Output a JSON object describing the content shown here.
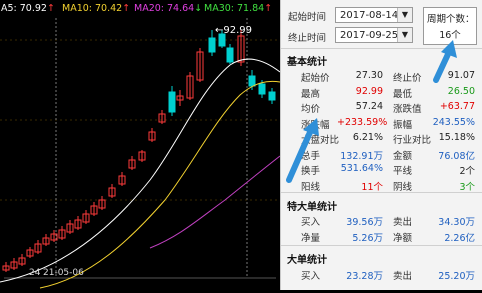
{
  "ma_legend": [
    {
      "label": "A5: 70.92",
      "arrow": "↑",
      "color": "#ffffff"
    },
    {
      "label": "MA10: 70.42",
      "arrow": "↑",
      "color": "#f2d130"
    },
    {
      "label": "MA20: 74.64",
      "arrow": "↓",
      "color": "#e040e0"
    },
    {
      "label": "MA30: 71.84",
      "arrow": "↑",
      "color": "#40e040"
    }
  ],
  "chart": {
    "peak_label": "92.99",
    "date_label": "21-05-06",
    "axis_label": "24",
    "colors": {
      "up": "#ff3b3b",
      "down": "#00d0d0",
      "ma5": "#ffffff",
      "ma10": "#f2d130",
      "ma20": "#c040c0"
    }
  },
  "period": {
    "start_label": "起始时间",
    "start_value": "2017-08-14",
    "end_label": "终止时间",
    "end_value": "2017-09-25",
    "count_label": "周期个数：",
    "count_value": "16个"
  },
  "basic": {
    "title": "基本统计",
    "rows": [
      {
        "l1": "起始价",
        "v1": "27.30",
        "c1": "#222222",
        "l2": "终止价",
        "v2": "91.07",
        "c2": "#222222"
      },
      {
        "l1": "最高",
        "v1": "92.99",
        "c1": "#e00000",
        "l2": "最低",
        "v2": "26.50",
        "c2": "#1a9a1a"
      },
      {
        "l1": "均价",
        "v1": "57.24",
        "c1": "#222222",
        "l2": "涨跌值",
        "v2": "+63.77",
        "c2": "#e00000"
      },
      {
        "l1": "涨跌幅",
        "v1": "+233.59%",
        "c1": "#e00000",
        "l2": "振幅",
        "v2": "243.55%",
        "c2": "#2060c0"
      },
      {
        "l1": "大盘对比",
        "v1": "6.21%",
        "c1": "#222222",
        "l2": "行业对比",
        "v2": "15.18%",
        "c2": "#222222"
      },
      {
        "l1": "总手",
        "v1": "132.91万",
        "c1": "#2060c0",
        "l2": "金额",
        "v2": "76.08亿",
        "c2": "#2060c0"
      },
      {
        "l1": "换手",
        "v1": "531.64%",
        "c1": "#2060c0",
        "l2": "平线",
        "v2": "2个",
        "c2": "#222222"
      },
      {
        "l1": "阳线",
        "v1": "11个",
        "c1": "#e00000",
        "l2": "阴线",
        "v2": "3个",
        "c2": "#1a9a1a"
      }
    ]
  },
  "big_orders": {
    "title": "特大单统计",
    "rows": [
      {
        "l1": "买入",
        "v1": "39.56万",
        "c1": "#2060c0",
        "l2": "卖出",
        "v2": "34.30万",
        "c2": "#2060c0"
      },
      {
        "l1": "净量",
        "v1": "5.26万",
        "c1": "#2060c0",
        "l2": "净额",
        "v2": "2.26亿",
        "c2": "#2060c0"
      }
    ]
  },
  "large_orders": {
    "title": "大单统计",
    "rows": [
      {
        "l1": "买入",
        "v1": "23.28万",
        "c1": "#2060c0",
        "l2": "卖出",
        "v2": "25.20万",
        "c2": "#2060c0"
      }
    ]
  }
}
